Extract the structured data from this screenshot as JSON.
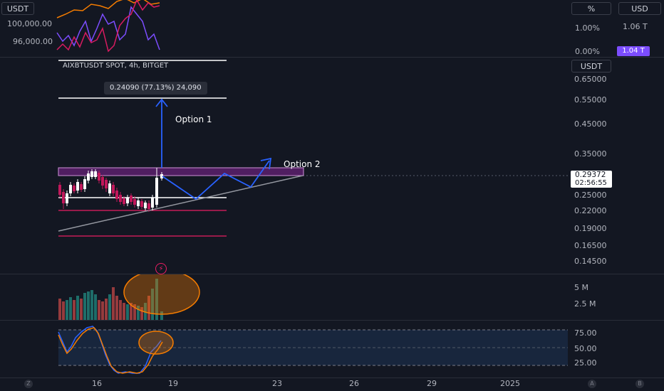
{
  "top_pane": {
    "currency_chip": "USDT",
    "percent_chip": "%",
    "usd_chip": "USD",
    "left_labels": [
      "100,000.00",
      "96,000.00"
    ],
    "right_labels": [
      "1.00%",
      "0.00%"
    ],
    "right_far_labels": [
      "1.06 T"
    ],
    "highlight_tag": "1.04 T"
  },
  "main_pane": {
    "symbol_info": "AIXBTUSDT SPOT, 4h, BITGET",
    "measure_label": "0.24090 (77.13%) 24,090",
    "option1_label": "Option 1",
    "option2_label": "Option 2",
    "currency_chip": "USDT",
    "price_ticks": [
      "0.65000",
      "0.55000",
      "0.45000",
      "0.35000",
      "0.25000",
      "0.22000",
      "0.19000",
      "0.16500",
      "0.14500"
    ],
    "price_tag": "0.29372",
    "countdown": "02:56:55"
  },
  "volume_pane": {
    "ticks": [
      "5 M",
      "2.5 M"
    ]
  },
  "stoch_pane": {
    "ticks": [
      "75.00",
      "50.00",
      "25.00"
    ]
  },
  "time_axis": {
    "labels": [
      "16",
      "19",
      "23",
      "26",
      "29",
      "2025"
    ],
    "left_icon": "Z",
    "right_icons": [
      "A",
      "B"
    ]
  },
  "colors": {
    "background": "#131722",
    "up_candle": "#ffffff",
    "down_candle": "#c2185b",
    "box_fill": "#9c27b0",
    "projection": "#2962ff",
    "highlight_circle": "#f57c00",
    "vol_up": "#26a69a",
    "vol_down": "#ef5350",
    "price_tag_bg": "#ffffff"
  }
}
